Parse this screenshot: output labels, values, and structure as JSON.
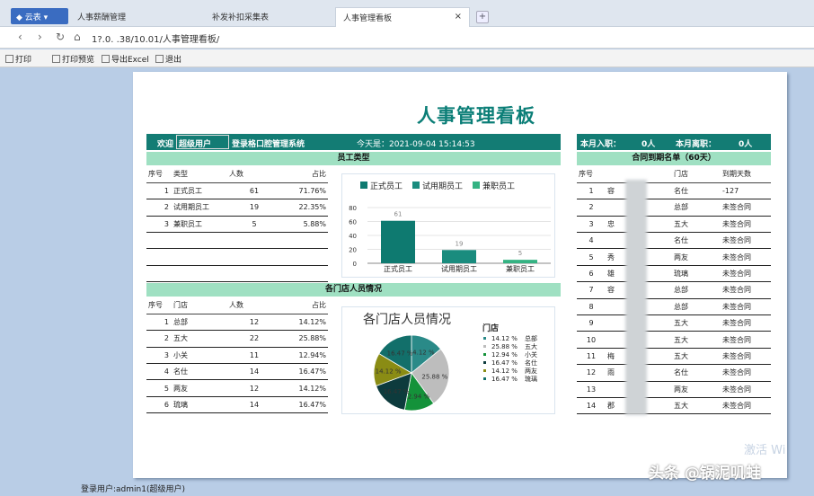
{
  "tabs": {
    "app": "云表",
    "t1": "人事薪酬管理",
    "t2": "补发补扣采集表",
    "t3": "人事管理看板",
    "close": "×",
    "new": "+"
  },
  "address": {
    "url": "1?.0.  .38/10.01/人事管理看板/"
  },
  "toolbar": {
    "print": "打印",
    "preview": "打印预览",
    "export": "导出Excel",
    "exit": "退出"
  },
  "report": {
    "title": "人事管理看板",
    "welcome_label": "欢迎",
    "user": "超级用户",
    "system": "登录格口腔管理系统",
    "today": "今天是：2021-09-04 15:14:53",
    "month_join_label": "本月入职：",
    "month_join": "0人",
    "month_leave_label": "本月离职：",
    "month_leave": "0人"
  },
  "employee_types": {
    "header": "员工类型",
    "columns": [
      "序号",
      "类型",
      "人数",
      "占比"
    ],
    "rows": [
      [
        "1",
        "正式员工",
        "61",
        "71.76%"
      ],
      [
        "2",
        "试用期员工",
        "19",
        "22.35%"
      ],
      [
        "3",
        "兼职员工",
        "5",
        "5.88%"
      ]
    ]
  },
  "stores": {
    "header": "各门店人员情况",
    "columns": [
      "序号",
      "门店",
      "人数",
      "占比"
    ],
    "rows": [
      [
        "1",
        "总部",
        "12",
        "14.12%"
      ],
      [
        "2",
        "五大",
        "22",
        "25.88%"
      ],
      [
        "3",
        "小关",
        "11",
        "12.94%"
      ],
      [
        "4",
        "名仕",
        "14",
        "16.47%"
      ],
      [
        "5",
        "两友",
        "12",
        "14.12%"
      ],
      [
        "6",
        "琉璃",
        "14",
        "16.47%"
      ]
    ]
  },
  "contracts": {
    "header": "合同到期名单（60天）",
    "columns": [
      "序号",
      "",
      "门店",
      "到期天数"
    ],
    "rows": [
      [
        "1",
        "容",
        "名仕",
        "-127"
      ],
      [
        "2",
        "",
        "总部",
        "未签合同"
      ],
      [
        "3",
        "忠",
        "五大",
        "未签合同"
      ],
      [
        "4",
        "",
        "名仕",
        "未签合同"
      ],
      [
        "5",
        "秀",
        "两友",
        "未签合同"
      ],
      [
        "6",
        "雄",
        "琉璃",
        "未签合同"
      ],
      [
        "7",
        "容",
        "总部",
        "未签合同"
      ],
      [
        "8",
        "",
        "总部",
        "未签合同"
      ],
      [
        "9",
        "",
        "五大",
        "未签合同"
      ],
      [
        "10",
        "",
        "五大",
        "未签合同"
      ],
      [
        "11",
        "梅",
        "五大",
        "未签合同"
      ],
      [
        "12",
        "雨",
        "名仕",
        "未签合同"
      ],
      [
        "13",
        "",
        "两友",
        "未签合同"
      ],
      [
        "14",
        "郡",
        "五大",
        "未签合同"
      ]
    ]
  },
  "chart_data": [
    {
      "type": "bar",
      "categories": [
        "正式员工",
        "试用期员工",
        "兼职员工"
      ],
      "series": [
        {
          "name": "正式员工",
          "values": [
            61,
            null,
            null
          ],
          "color": "#0e7a70"
        },
        {
          "name": "试用期员工",
          "values": [
            null,
            19,
            null
          ],
          "color": "#1a8c7e"
        },
        {
          "name": "兼职员工",
          "values": [
            null,
            null,
            5
          ],
          "color": "#35b383"
        }
      ],
      "values": [
        61,
        19,
        5
      ],
      "ylim": [
        0,
        80
      ],
      "yticks": [
        "80",
        "60",
        "40",
        "20",
        "0"
      ],
      "grid": true,
      "legend": "top"
    },
    {
      "type": "pie",
      "title": "各门店人员情况",
      "labels": [
        "总部",
        "五大",
        "小关",
        "名仕",
        "两友",
        "琉璃"
      ],
      "values": [
        14.12,
        25.88,
        12.94,
        16.47,
        14.12,
        16.47
      ],
      "slice_labels": [
        "14.12 %",
        "25.88 %",
        "12.94 %",
        "16.47 %",
        "14.12 %",
        "16.47 %"
      ],
      "colors": [
        "#2a8a88",
        "#bdbdbd",
        "#14923a",
        "#0d3b3d",
        "#8a8c14",
        "#126f6a"
      ],
      "legend_title": "门店",
      "legend": "right"
    }
  ],
  "footer": {
    "status": "登录用户:admin1(超级用户)",
    "watermark": "头条 @锅泥叽蛙",
    "activate": "激活 Wi"
  }
}
